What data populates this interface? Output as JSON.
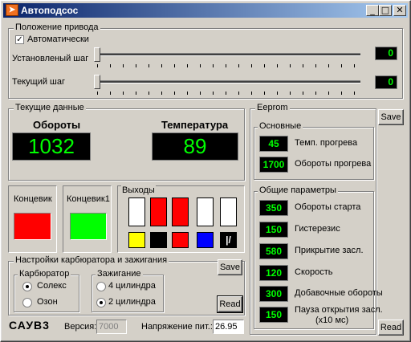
{
  "window": {
    "title": "Автоподсос",
    "min": "_",
    "max": "□",
    "close": "✕",
    "icon": "➤"
  },
  "drive": {
    "group_label": "Положение привода",
    "auto_label": "Автоматически",
    "auto_checked": true,
    "check_mark": "✓",
    "set_step_label": "Установленый шаг",
    "set_step_value": "0",
    "cur_step_label": "Текущий шаг",
    "cur_step_value": "0"
  },
  "current": {
    "group_label": "Текущие данные",
    "rpm_label": "Обороты",
    "rpm_value": "1032",
    "temp_label": "Температура",
    "temp_value": "89"
  },
  "limits": {
    "k1": "Концевик",
    "k1_color": "#ff0000",
    "k2": "Концевик1",
    "k2_color": "#00ff00"
  },
  "outputs": {
    "label": "Выходы",
    "top": [
      "#ffffff",
      "#ff0000",
      "#ff0000",
      "#ffffff",
      "#ffffff"
    ],
    "bottom": [
      "#ffff00",
      "#000000",
      "#ff0000",
      "#0000ff"
    ],
    "last_glyph": "|/"
  },
  "carb": {
    "group_label": "Настройки карбюратора и зажигания",
    "save": "Save",
    "read": "Read",
    "carb_label": "Карбюратор",
    "carb_opt1": "Солекс",
    "carb_opt2": "Озон",
    "ign_label": "Зажигание",
    "ign_opt1": "4 цилиндра",
    "ign_opt2": "2 цилиндра"
  },
  "footer": {
    "brand": "САУВ3",
    "version_label": "Версия:",
    "version_value": "7000",
    "voltage_label": "Напряжение пит.:",
    "voltage_value": "26.95"
  },
  "eeprom": {
    "label": "Eeprom",
    "save": "Save",
    "read": "Read",
    "basic_label": "Основные",
    "basic": [
      {
        "value": "45",
        "label": "Темп. прогрева"
      },
      {
        "value": "1700",
        "label": "Обороты прогрева"
      }
    ],
    "common_label": "Общие параметры",
    "common": [
      {
        "value": "350",
        "label": "Обороты старта"
      },
      {
        "value": "150",
        "label": "Гистерезис"
      },
      {
        "value": "580",
        "label": "Прикрытие засл."
      },
      {
        "value": "120",
        "label": "Скорость"
      },
      {
        "value": "300",
        "label": "Добавочные обороты"
      },
      {
        "value": "150",
        "label": "Пауза открытия засл.",
        "label2": "(x10 мс)"
      }
    ]
  }
}
